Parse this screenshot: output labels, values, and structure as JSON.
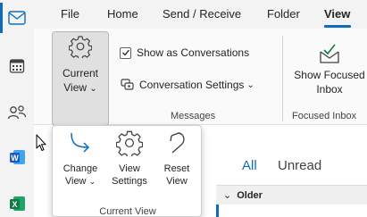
{
  "colors": {
    "accent": "#0f6cbd",
    "ribbon_bg": "#fafafa",
    "nav_bg": "#f3f3f3",
    "word_blue": "#185abd",
    "excel_green": "#107c41"
  },
  "menubar": {
    "items": [
      "File",
      "Home",
      "Send / Receive",
      "Folder",
      "View"
    ],
    "active": "View"
  },
  "leftbar": {
    "icons": [
      "mail-icon",
      "calendar-icon",
      "people-icon",
      "word-icon",
      "excel-icon"
    ],
    "word_letter": "W",
    "excel_letter": "X"
  },
  "ribbon": {
    "current_view": {
      "line1": "Current",
      "line2": "View",
      "chevron": "⌄"
    },
    "messages": {
      "show_as_conversations": "Show as Conversations",
      "show_as_conversations_checked": true,
      "conversation_settings": "Conversation Settings",
      "chevron": "⌄",
      "group_label": "Messages"
    },
    "focused": {
      "line1": "Show Focused",
      "line2": "Inbox",
      "group_label": "Focused Inbox"
    }
  },
  "dropdown": {
    "change_view": {
      "line1": "Change",
      "line2": "View",
      "chevron": "⌄"
    },
    "view_settings": {
      "line1": "View",
      "line2": "Settings"
    },
    "reset_view": {
      "line1": "Reset",
      "line2": "View"
    },
    "group_label": "Current View"
  },
  "content": {
    "tab_all": "All",
    "tab_unread": "Unread",
    "older_label": "Older",
    "older_chevron": "⌄"
  }
}
